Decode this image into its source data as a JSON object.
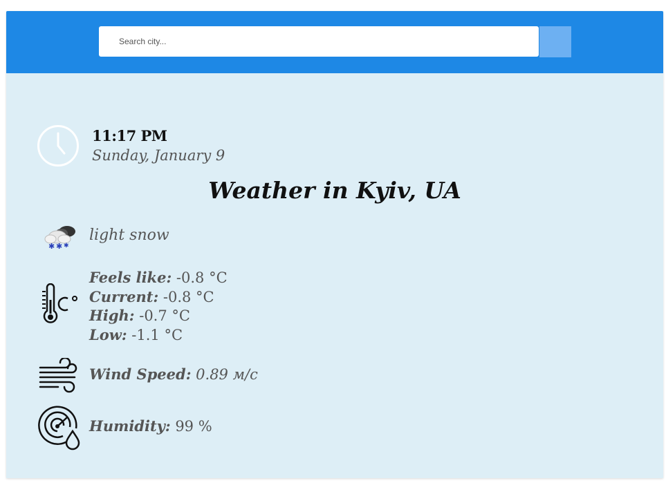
{
  "search": {
    "placeholder": "Search city..."
  },
  "datetime": {
    "time": "11:17 PM",
    "date": "Sunday, January 9"
  },
  "title": "Weather in Kyiv, UA",
  "conditions": {
    "description": "light snow",
    "icon": "snow-cloud-icon"
  },
  "temperature": {
    "feels_like_label": "Feels like:",
    "feels_like_value": "-0.8 °C",
    "current_label": "Current:",
    "current_value": "-0.8 °C",
    "high_label": "High:",
    "high_value": "-0.7 °C",
    "low_label": "Low:",
    "low_value": "-1.1 °C"
  },
  "wind": {
    "label": "Wind Speed:",
    "value": "0.89 м/с"
  },
  "humidity": {
    "label": "Humidity:",
    "value": "99 %"
  },
  "colors": {
    "header": "#1e88e5",
    "card": "#ddeef6",
    "search_button": "#6db0f2"
  }
}
